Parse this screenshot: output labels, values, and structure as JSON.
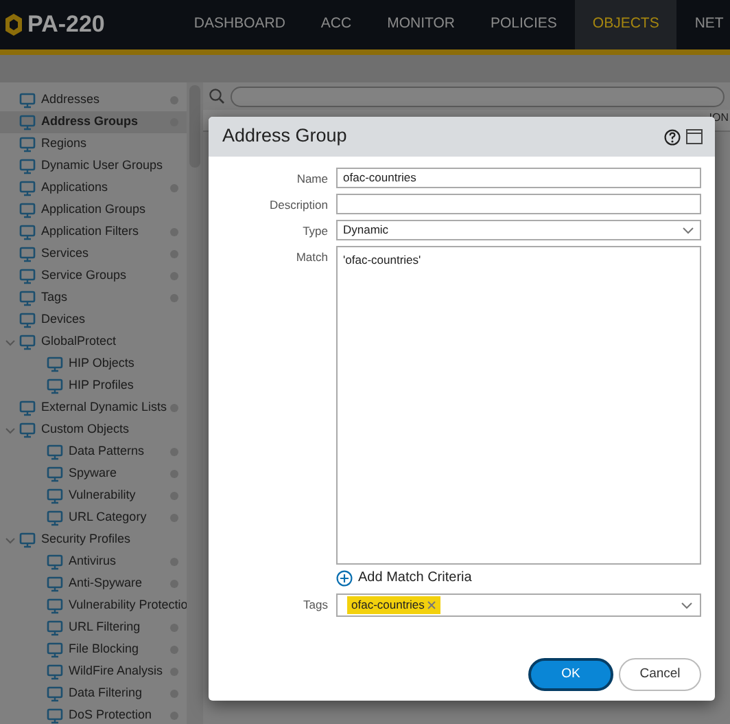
{
  "app": {
    "logo_text": "PA-220"
  },
  "nav_tabs": [
    {
      "label": "DASHBOARD",
      "selected": false
    },
    {
      "label": "ACC",
      "selected": false
    },
    {
      "label": "MONITOR",
      "selected": false
    },
    {
      "label": "POLICIES",
      "selected": false
    },
    {
      "label": "OBJECTS",
      "selected": true
    },
    {
      "label": "NET",
      "selected": false
    }
  ],
  "sidebar": {
    "items": [
      {
        "label": "Addresses",
        "selected": false,
        "marked": true
      },
      {
        "label": "Address Groups",
        "selected": true,
        "marked": true
      },
      {
        "label": "Regions",
        "selected": false,
        "marked": false
      },
      {
        "label": "Dynamic User Groups",
        "selected": false,
        "marked": false
      },
      {
        "label": "Applications",
        "selected": false,
        "marked": true
      },
      {
        "label": "Application Groups",
        "selected": false,
        "marked": false
      },
      {
        "label": "Application Filters",
        "selected": false,
        "marked": true
      },
      {
        "label": "Services",
        "selected": false,
        "marked": true
      },
      {
        "label": "Service Groups",
        "selected": false,
        "marked": true
      },
      {
        "label": "Tags",
        "selected": false,
        "marked": true
      },
      {
        "label": "Devices",
        "selected": false,
        "marked": false
      },
      {
        "label": "GlobalProtect",
        "selected": false,
        "marked": false,
        "expanded": true,
        "children": [
          {
            "label": "HIP Objects",
            "selected": false,
            "marked": false
          },
          {
            "label": "HIP Profiles",
            "selected": false,
            "marked": false
          }
        ]
      },
      {
        "label": "External Dynamic Lists",
        "selected": false,
        "marked": true
      },
      {
        "label": "Custom Objects",
        "selected": false,
        "marked": false,
        "expanded": true,
        "children": [
          {
            "label": "Data Patterns",
            "selected": false,
            "marked": true
          },
          {
            "label": "Spyware",
            "selected": false,
            "marked": true
          },
          {
            "label": "Vulnerability",
            "selected": false,
            "marked": true
          },
          {
            "label": "URL Category",
            "selected": false,
            "marked": true
          }
        ]
      },
      {
        "label": "Security Profiles",
        "selected": false,
        "marked": false,
        "expanded": true,
        "children": [
          {
            "label": "Antivirus",
            "selected": false,
            "marked": true
          },
          {
            "label": "Anti-Spyware",
            "selected": false,
            "marked": true
          },
          {
            "label": "Vulnerability Protectio",
            "selected": false
          },
          {
            "label": "URL Filtering",
            "selected": false,
            "marked": true
          },
          {
            "label": "File Blocking",
            "selected": false,
            "marked": true
          },
          {
            "label": "WildFire Analysis",
            "selected": false,
            "marked": true
          },
          {
            "label": "Data Filtering",
            "selected": false,
            "marked": true
          },
          {
            "label": "DoS Protection",
            "selected": false,
            "marked": true
          }
        ]
      }
    ]
  },
  "table": {
    "columns": [
      "ION"
    ]
  },
  "dialog": {
    "title": "Address Group",
    "fields": [
      {
        "label": "Name",
        "kind": "text",
        "value": "ofac-countries"
      },
      {
        "label": "Description",
        "kind": "text"
      },
      {
        "label": "Type",
        "kind": "select",
        "value": "Dynamic"
      },
      {
        "label": "Match",
        "kind": "textarea",
        "value": "'ofac-countries'"
      }
    ],
    "add_link": "Add Match Criteria",
    "tags": {
      "label": "Tags",
      "items": [
        "ofac-countries"
      ]
    },
    "buttons": [
      {
        "label": "OK",
        "kind": "primary"
      },
      {
        "label": "Cancel",
        "kind": "secondary"
      }
    ]
  }
}
